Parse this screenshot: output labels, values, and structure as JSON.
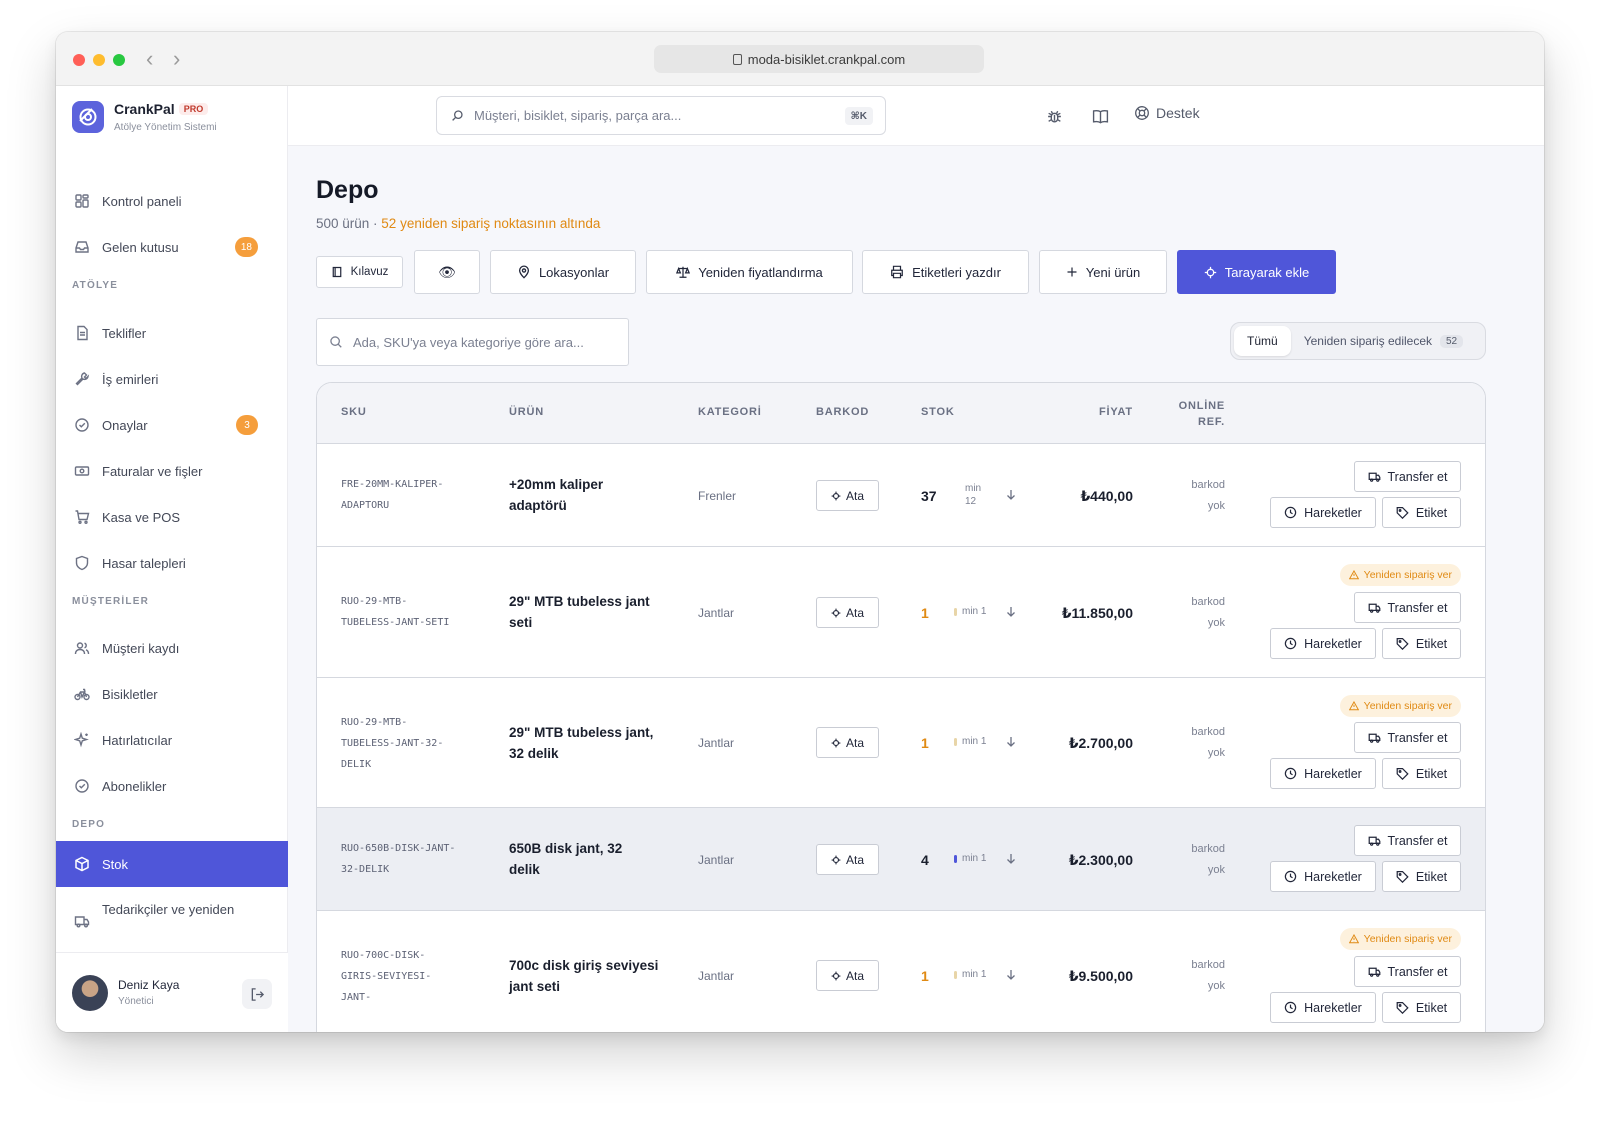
{
  "browser": {
    "url": "moda-bisiklet.crankpal.com"
  },
  "brand": {
    "name": "CrankPal",
    "badge": "PRO",
    "subtitle": "Atölye Yönetim Sistemi"
  },
  "topbar": {
    "search_placeholder": "Müşteri, bisiklet, sipariş, parça ara...",
    "shortcut": "⌘K",
    "support_label": "Destek"
  },
  "sidebar": {
    "items_top": [
      {
        "label": "Kontrol paneli",
        "icon": "dashboard-icon"
      },
      {
        "label": "Gelen kutusu",
        "icon": "inbox-icon",
        "badge": "18"
      }
    ],
    "section_atolye": "ATÖLYE",
    "items_atolye": [
      {
        "label": "Teklifler",
        "icon": "document-icon"
      },
      {
        "label": "İş emirleri",
        "icon": "wrench-icon"
      },
      {
        "label": "Onaylar",
        "icon": "check-circle-icon",
        "badge": "3"
      },
      {
        "label": "Faturalar ve fişler",
        "icon": "banknote-icon"
      },
      {
        "label": "Kasa ve POS",
        "icon": "cart-icon"
      },
      {
        "label": "Hasar talepleri",
        "icon": "shield-icon"
      }
    ],
    "section_musteriler": "MÜŞTERİLER",
    "items_musteriler": [
      {
        "label": "Müşteri kaydı",
        "icon": "users-icon"
      },
      {
        "label": "Bisikletler",
        "icon": "bike-icon"
      },
      {
        "label": "Hatırlatıcılar",
        "icon": "sparkle-icon"
      },
      {
        "label": "Abonelikler",
        "icon": "check-circle-icon"
      }
    ],
    "section_depo": "DEPO",
    "items_depo": [
      {
        "label": "Stok",
        "icon": "box-icon",
        "active": true
      },
      {
        "label": "Tedarikçiler ve yeniden",
        "icon": "truck-icon"
      }
    ],
    "user": {
      "name": "Deniz Kaya",
      "role": "Yönetici"
    }
  },
  "page": {
    "title": "Depo",
    "count_text": "500 ürün · ",
    "warning_text": "52 yeniden sipariş noktasının altında"
  },
  "actions": {
    "guide": "Kılavuz",
    "locations": "Lokasyonlar",
    "reprice": "Yeniden fiyatlandırma",
    "print_labels": "Etiketleri yazdır",
    "new_product": "Yeni ürün",
    "scan_add": "Tarayarak ekle"
  },
  "table_search_placeholder": "Ada, SKU'ya veya kategoriye göre ara...",
  "filter": {
    "all": "Tümü",
    "reorder": "Yeniden sipariş edilecek",
    "reorder_count": "52"
  },
  "table": {
    "headers": {
      "sku": "SKU",
      "product": "ÜRÜN",
      "category": "KATEGORİ",
      "barcode": "BARKOD",
      "stock": "STOK",
      "price": "FİYAT",
      "online_1": "ONLİNE",
      "online_2": "REF."
    },
    "assign_label": "Ata",
    "transfer_label": "Transfer et",
    "movements_label": "Hareketler",
    "label_label": "Etiket",
    "reorder_badge": "Yeniden sipariş ver",
    "online_1": "barkod",
    "online_2": "yok",
    "rows": [
      {
        "sku": [
          "FRE-20MM-KALIPER-",
          "ADAPTORU"
        ],
        "product": [
          "+20mm kaliper",
          "adaptörü"
        ],
        "category": "Frenler",
        "stock": "37",
        "min": [
          "min",
          "12"
        ],
        "price": "₺440,00",
        "low": false
      },
      {
        "sku": [
          "RUO-29-MTB-",
          "TUBELESS-JANT-SETI"
        ],
        "product": [
          "29\" MTB tubeless jant",
          "seti"
        ],
        "category": "Jantlar",
        "stock": "1",
        "min": [
          "min 1"
        ],
        "price": "₺11.850,00",
        "low": true
      },
      {
        "sku": [
          "RUO-29-MTB-",
          "TUBELESS-JANT-32-",
          "DELIK"
        ],
        "product": [
          "29\" MTB tubeless jant,",
          "32 delik"
        ],
        "category": "Jantlar",
        "stock": "1",
        "min": [
          "min 1"
        ],
        "price": "₺2.700,00",
        "low": true
      },
      {
        "sku": [
          "RUO-650B-DISK-JANT-",
          "32-DELIK"
        ],
        "product": [
          "650B disk jant, 32",
          "delik"
        ],
        "category": "Jantlar",
        "stock": "4",
        "min": [
          "min 1"
        ],
        "price": "₺2.300,00",
        "low": false
      },
      {
        "sku": [
          "RUO-700C-DISK-",
          "GIRIS-SEVIYESI-",
          "JANT-"
        ],
        "product": [
          "700c disk giriş seviyesi",
          "jant seti"
        ],
        "category": "Jantlar",
        "stock": "1",
        "min": [
          "min 1"
        ],
        "price": "₺9.500,00",
        "low": true
      }
    ]
  }
}
